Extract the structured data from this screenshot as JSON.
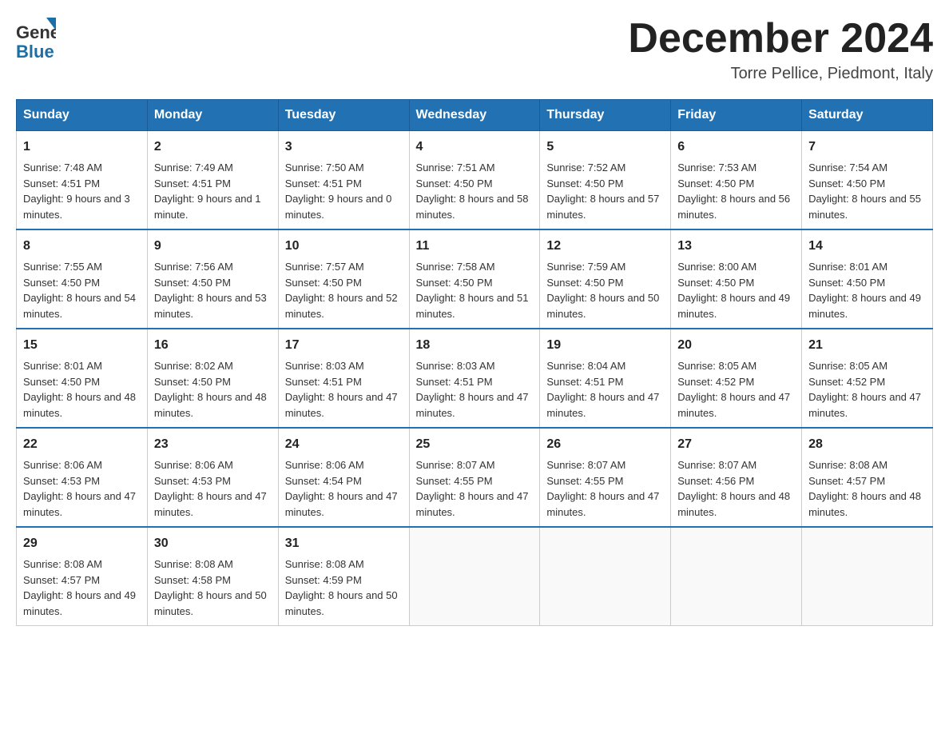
{
  "header": {
    "logo": {
      "general": "General",
      "blue": "Blue",
      "triangle_color": "#1a6fa8"
    },
    "title": "December 2024",
    "location": "Torre Pellice, Piedmont, Italy"
  },
  "days_of_week": [
    "Sunday",
    "Monday",
    "Tuesday",
    "Wednesday",
    "Thursday",
    "Friday",
    "Saturday"
  ],
  "weeks": [
    {
      "days": [
        {
          "num": "1",
          "sunrise": "7:48 AM",
          "sunset": "4:51 PM",
          "daylight": "9 hours and 3 minutes."
        },
        {
          "num": "2",
          "sunrise": "7:49 AM",
          "sunset": "4:51 PM",
          "daylight": "9 hours and 1 minute."
        },
        {
          "num": "3",
          "sunrise": "7:50 AM",
          "sunset": "4:51 PM",
          "daylight": "9 hours and 0 minutes."
        },
        {
          "num": "4",
          "sunrise": "7:51 AM",
          "sunset": "4:50 PM",
          "daylight": "8 hours and 58 minutes."
        },
        {
          "num": "5",
          "sunrise": "7:52 AM",
          "sunset": "4:50 PM",
          "daylight": "8 hours and 57 minutes."
        },
        {
          "num": "6",
          "sunrise": "7:53 AM",
          "sunset": "4:50 PM",
          "daylight": "8 hours and 56 minutes."
        },
        {
          "num": "7",
          "sunrise": "7:54 AM",
          "sunset": "4:50 PM",
          "daylight": "8 hours and 55 minutes."
        }
      ]
    },
    {
      "days": [
        {
          "num": "8",
          "sunrise": "7:55 AM",
          "sunset": "4:50 PM",
          "daylight": "8 hours and 54 minutes."
        },
        {
          "num": "9",
          "sunrise": "7:56 AM",
          "sunset": "4:50 PM",
          "daylight": "8 hours and 53 minutes."
        },
        {
          "num": "10",
          "sunrise": "7:57 AM",
          "sunset": "4:50 PM",
          "daylight": "8 hours and 52 minutes."
        },
        {
          "num": "11",
          "sunrise": "7:58 AM",
          "sunset": "4:50 PM",
          "daylight": "8 hours and 51 minutes."
        },
        {
          "num": "12",
          "sunrise": "7:59 AM",
          "sunset": "4:50 PM",
          "daylight": "8 hours and 50 minutes."
        },
        {
          "num": "13",
          "sunrise": "8:00 AM",
          "sunset": "4:50 PM",
          "daylight": "8 hours and 49 minutes."
        },
        {
          "num": "14",
          "sunrise": "8:01 AM",
          "sunset": "4:50 PM",
          "daylight": "8 hours and 49 minutes."
        }
      ]
    },
    {
      "days": [
        {
          "num": "15",
          "sunrise": "8:01 AM",
          "sunset": "4:50 PM",
          "daylight": "8 hours and 48 minutes."
        },
        {
          "num": "16",
          "sunrise": "8:02 AM",
          "sunset": "4:50 PM",
          "daylight": "8 hours and 48 minutes."
        },
        {
          "num": "17",
          "sunrise": "8:03 AM",
          "sunset": "4:51 PM",
          "daylight": "8 hours and 47 minutes."
        },
        {
          "num": "18",
          "sunrise": "8:03 AM",
          "sunset": "4:51 PM",
          "daylight": "8 hours and 47 minutes."
        },
        {
          "num": "19",
          "sunrise": "8:04 AM",
          "sunset": "4:51 PM",
          "daylight": "8 hours and 47 minutes."
        },
        {
          "num": "20",
          "sunrise": "8:05 AM",
          "sunset": "4:52 PM",
          "daylight": "8 hours and 47 minutes."
        },
        {
          "num": "21",
          "sunrise": "8:05 AM",
          "sunset": "4:52 PM",
          "daylight": "8 hours and 47 minutes."
        }
      ]
    },
    {
      "days": [
        {
          "num": "22",
          "sunrise": "8:06 AM",
          "sunset": "4:53 PM",
          "daylight": "8 hours and 47 minutes."
        },
        {
          "num": "23",
          "sunrise": "8:06 AM",
          "sunset": "4:53 PM",
          "daylight": "8 hours and 47 minutes."
        },
        {
          "num": "24",
          "sunrise": "8:06 AM",
          "sunset": "4:54 PM",
          "daylight": "8 hours and 47 minutes."
        },
        {
          "num": "25",
          "sunrise": "8:07 AM",
          "sunset": "4:55 PM",
          "daylight": "8 hours and 47 minutes."
        },
        {
          "num": "26",
          "sunrise": "8:07 AM",
          "sunset": "4:55 PM",
          "daylight": "8 hours and 47 minutes."
        },
        {
          "num": "27",
          "sunrise": "8:07 AM",
          "sunset": "4:56 PM",
          "daylight": "8 hours and 48 minutes."
        },
        {
          "num": "28",
          "sunrise": "8:08 AM",
          "sunset": "4:57 PM",
          "daylight": "8 hours and 48 minutes."
        }
      ]
    },
    {
      "days": [
        {
          "num": "29",
          "sunrise": "8:08 AM",
          "sunset": "4:57 PM",
          "daylight": "8 hours and 49 minutes."
        },
        {
          "num": "30",
          "sunrise": "8:08 AM",
          "sunset": "4:58 PM",
          "daylight": "8 hours and 50 minutes."
        },
        {
          "num": "31",
          "sunrise": "8:08 AM",
          "sunset": "4:59 PM",
          "daylight": "8 hours and 50 minutes."
        },
        {
          "num": "",
          "sunrise": "",
          "sunset": "",
          "daylight": ""
        },
        {
          "num": "",
          "sunrise": "",
          "sunset": "",
          "daylight": ""
        },
        {
          "num": "",
          "sunrise": "",
          "sunset": "",
          "daylight": ""
        },
        {
          "num": "",
          "sunrise": "",
          "sunset": "",
          "daylight": ""
        }
      ]
    }
  ],
  "labels": {
    "sunrise": "Sunrise:",
    "sunset": "Sunset:",
    "daylight": "Daylight:"
  }
}
